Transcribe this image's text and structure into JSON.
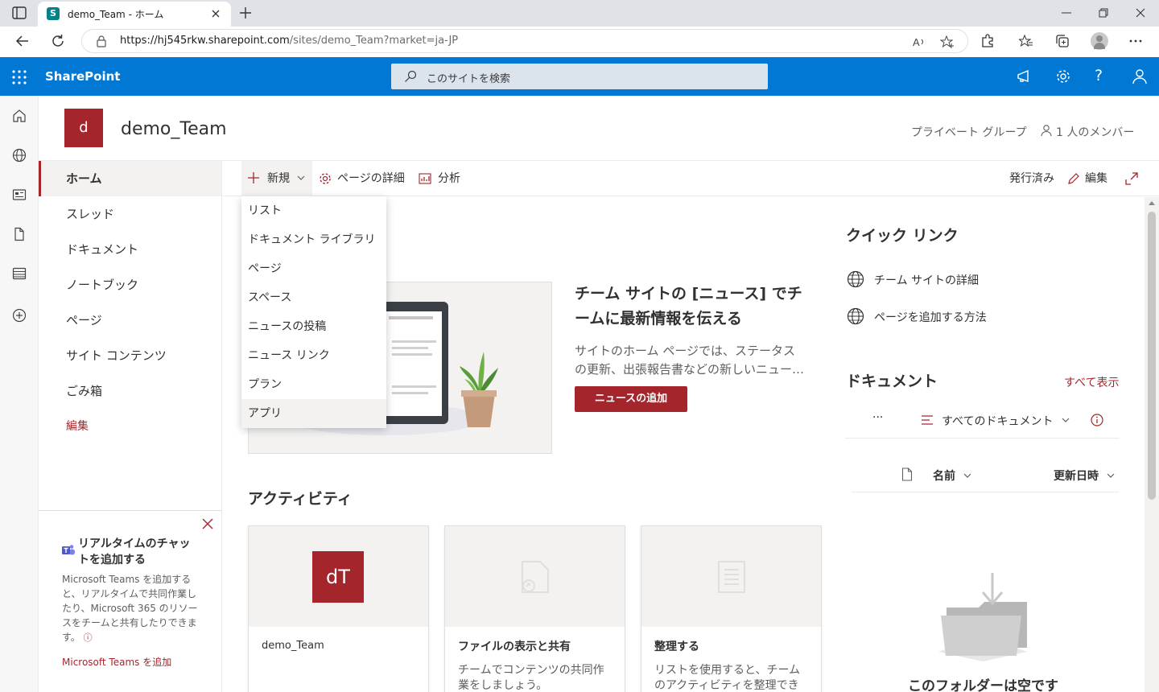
{
  "browser": {
    "tab_title": "demo_Team - ホーム",
    "favicon_letter": "S",
    "url_host": "https://hj545rkw.sharepoint.com",
    "url_path": "/sites/demo_Team?market=ja-JP"
  },
  "suite": {
    "app_name": "SharePoint",
    "search_placeholder": "このサイトを検索"
  },
  "site": {
    "logo_letter": "d",
    "title": "demo_Team",
    "privacy": "プライベート グループ",
    "members": "1 人のメンバー"
  },
  "nav": {
    "items": [
      {
        "label": "ホーム"
      },
      {
        "label": "スレッド"
      },
      {
        "label": "ドキュメント"
      },
      {
        "label": "ノートブック"
      },
      {
        "label": "ページ"
      },
      {
        "label": "サイト コンテンツ"
      },
      {
        "label": "ごみ箱"
      }
    ],
    "edit_label": "編集"
  },
  "teams_card": {
    "title": "リアルタイムのチャットを追加する",
    "body": "Microsoft Teams を追加すると、リアルタイムで共同作業したり、Microsoft 365 のリソースをチームと共有したりできます。",
    "link": "Microsoft Teams を追加"
  },
  "commandbar": {
    "new_label": "新規",
    "page_details_label": "ページの詳細",
    "analytics_label": "分析",
    "published_label": "発行済み",
    "edit_label": "編集"
  },
  "new_menu": {
    "items": [
      {
        "label": "リスト"
      },
      {
        "label": "ドキュメント ライブラリ"
      },
      {
        "label": "ページ"
      },
      {
        "label": "スペース"
      },
      {
        "label": "ニュースの投稿"
      },
      {
        "label": "ニュース リンク"
      },
      {
        "label": "プラン"
      },
      {
        "label": "アプリ"
      }
    ]
  },
  "news": {
    "heading_line1": "チーム サイトの [ニュース] でチ",
    "heading_line2": "ームに最新情報を伝える",
    "body_line1": "サイトのホーム ページでは、ステータス",
    "body_line2": "の更新、出張報告書などの新しいニュー…",
    "add_button": "ニュースの追加"
  },
  "activity": {
    "heading": "アクティビティ",
    "cards": [
      {
        "thumb_text": "dT",
        "title": "demo_Team",
        "desc_line1": "",
        "desc_line2": ""
      },
      {
        "thumb_text": "",
        "title": "ファイルの表示と共有",
        "desc_line1": "チームでコンテンツの共同作",
        "desc_line2": "業をしましょう。"
      },
      {
        "thumb_text": "",
        "title": "整理する",
        "desc_line1": "リストを使用すると、チーム",
        "desc_line2": "のアクティビティを整理でき"
      }
    ]
  },
  "quicklinks": {
    "heading": "クイック リンク",
    "items": [
      {
        "label": "チーム サイトの詳細"
      },
      {
        "label": "ページを追加する方法"
      }
    ]
  },
  "documents": {
    "heading": "ドキュメント",
    "see_all": "すべて表示",
    "more": "···",
    "view_label": "すべてのドキュメント",
    "col_name": "名前",
    "col_modified": "更新日時",
    "empty_text": "このフォルダーは空です"
  },
  "colors": {
    "suite_blue": "#0078d4",
    "accent_red": "#a4262c"
  }
}
